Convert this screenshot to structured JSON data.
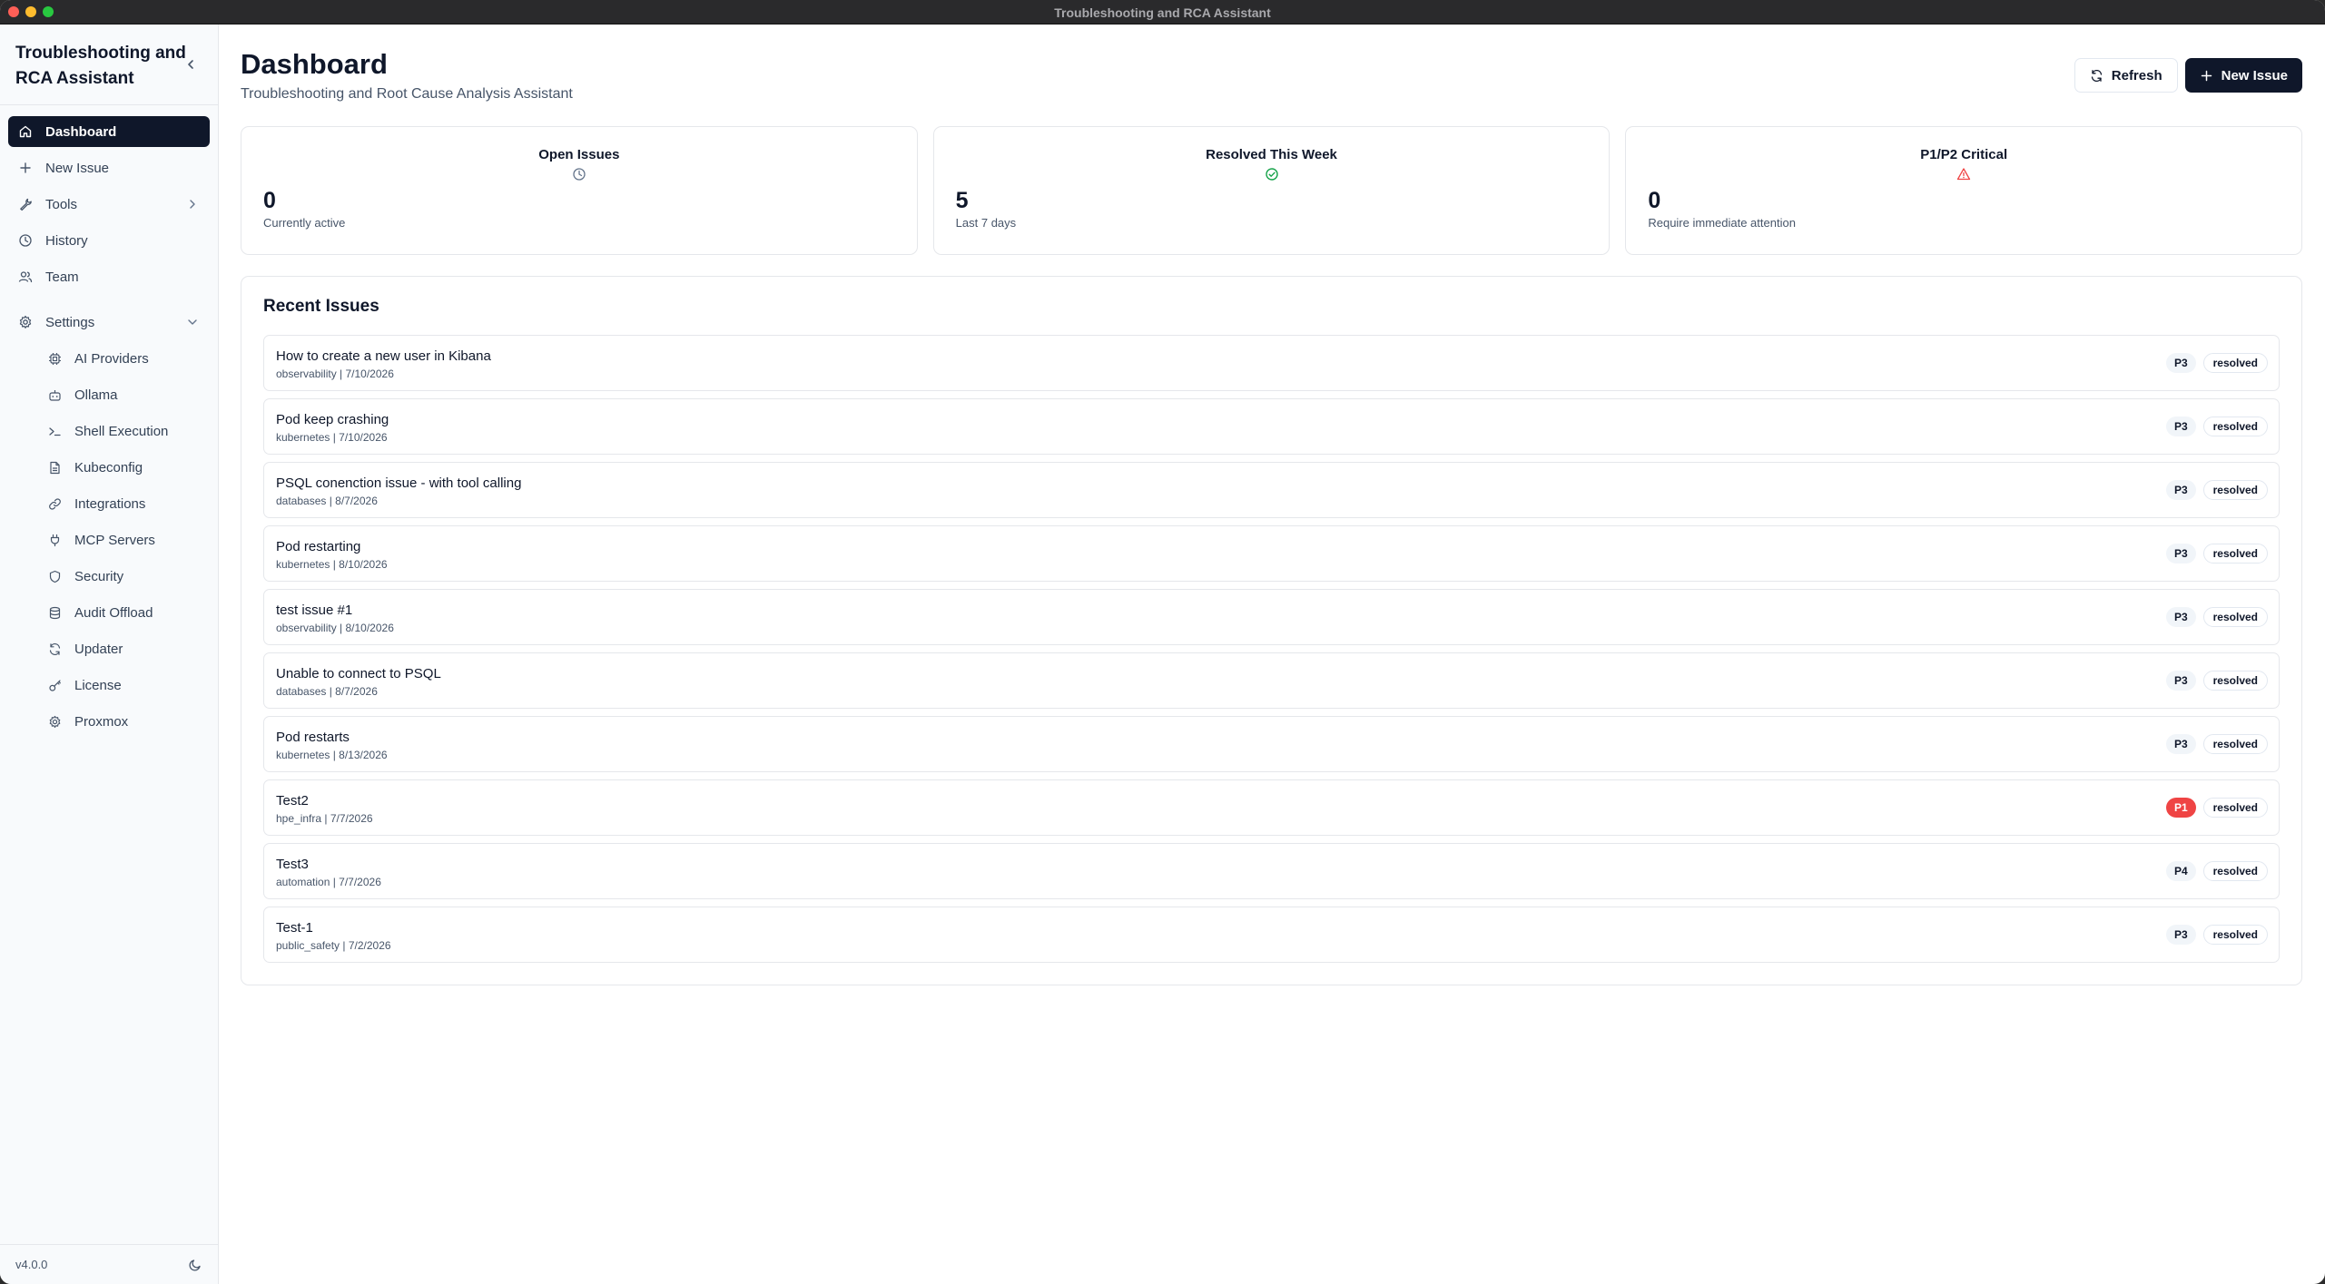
{
  "window": {
    "title": "Troubleshooting and RCA Assistant"
  },
  "sidebar": {
    "app_title": "Troubleshooting and RCA Assistant",
    "nav": [
      {
        "label": "Dashboard",
        "icon": "home-icon"
      },
      {
        "label": "New Issue",
        "icon": "plus-icon"
      },
      {
        "label": "Tools",
        "icon": "wrench-icon"
      },
      {
        "label": "History",
        "icon": "clock-icon"
      },
      {
        "label": "Team",
        "icon": "users-icon"
      }
    ],
    "settings": {
      "label": "Settings",
      "items": [
        {
          "label": "AI Providers",
          "icon": "cpu-icon"
        },
        {
          "label": "Ollama",
          "icon": "bot-icon"
        },
        {
          "label": "Shell Execution",
          "icon": "terminal-icon"
        },
        {
          "label": "Kubeconfig",
          "icon": "file-icon"
        },
        {
          "label": "Integrations",
          "icon": "link-icon"
        },
        {
          "label": "MCP Servers",
          "icon": "plug-icon"
        },
        {
          "label": "Security",
          "icon": "shield-icon"
        },
        {
          "label": "Audit Offload",
          "icon": "database-icon"
        },
        {
          "label": "Updater",
          "icon": "refresh-icon"
        },
        {
          "label": "License",
          "icon": "key-icon"
        },
        {
          "label": "Proxmox",
          "icon": "gear-icon"
        }
      ]
    },
    "version": "v4.0.0"
  },
  "header": {
    "title": "Dashboard",
    "subtitle": "Troubleshooting and Root Cause Analysis Assistant",
    "refresh_label": "Refresh",
    "new_issue_label": "New Issue"
  },
  "stats": [
    {
      "label": "Open Issues",
      "value": "0",
      "caption": "Currently active",
      "icon": "clock-icon"
    },
    {
      "label": "Resolved This Week",
      "value": "5",
      "caption": "Last 7 days",
      "icon": "check-circle-icon"
    },
    {
      "label": "P1/P2 Critical",
      "value": "0",
      "caption": "Require immediate attention",
      "icon": "alert-triangle-icon"
    }
  ],
  "recent": {
    "title": "Recent Issues",
    "issues": [
      {
        "title": "How to create a new user in Kibana",
        "meta": "observability | 7/10/2026",
        "priority": "P3",
        "status": "resolved"
      },
      {
        "title": "Pod keep crashing",
        "meta": "kubernetes | 7/10/2026",
        "priority": "P3",
        "status": "resolved"
      },
      {
        "title": "PSQL conenction issue - with tool calling",
        "meta": "databases | 8/7/2026",
        "priority": "P3",
        "status": "resolved"
      },
      {
        "title": "Pod restarting",
        "meta": "kubernetes | 8/10/2026",
        "priority": "P3",
        "status": "resolved"
      },
      {
        "title": "test issue #1",
        "meta": "observability | 8/10/2026",
        "priority": "P3",
        "status": "resolved"
      },
      {
        "title": "Unable to connect to PSQL",
        "meta": "databases | 8/7/2026",
        "priority": "P3",
        "status": "resolved"
      },
      {
        "title": "Pod restarts",
        "meta": "kubernetes | 8/13/2026",
        "priority": "P3",
        "status": "resolved"
      },
      {
        "title": "Test2",
        "meta": "hpe_infra | 7/7/2026",
        "priority": "P1",
        "status": "resolved"
      },
      {
        "title": "Test3",
        "meta": "automation | 7/7/2026",
        "priority": "P4",
        "status": "resolved"
      },
      {
        "title": "Test-1",
        "meta": "public_safety | 7/2/2026",
        "priority": "P3",
        "status": "resolved"
      }
    ]
  },
  "colors": {
    "primary": "#0f172a",
    "success": "#16a34a",
    "danger": "#ef4444",
    "muted": "#475569"
  }
}
